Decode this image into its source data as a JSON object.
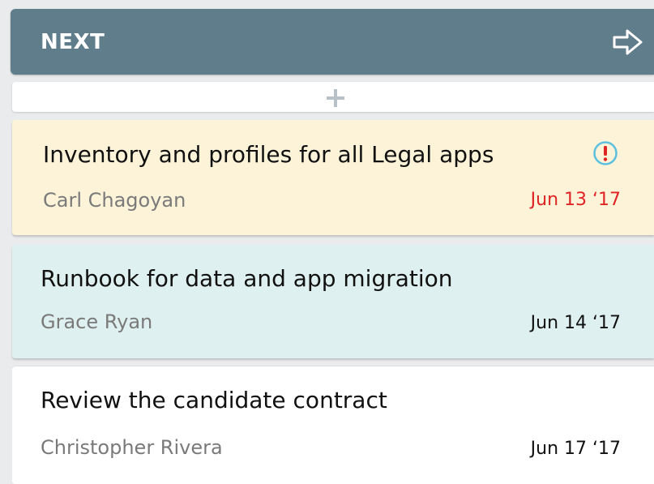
{
  "column": {
    "title": "NEXT",
    "move_icon": "arrow-right-icon",
    "add_icon": "plus-icon"
  },
  "cards": [
    {
      "title": "Inventory and profiles for all Legal apps",
      "assignee": "Carl Chagoyan",
      "due_date": "Jun 13 ‘17",
      "background": "#fdf3d9",
      "date_color": "#e02424",
      "status_icon": "alert-icon"
    },
    {
      "title": "Runbook for data and app migration",
      "assignee": "Grace Ryan",
      "due_date": "Jun 14 ‘17",
      "background": "#def0ef",
      "date_color": "#111111"
    },
    {
      "title": "Review the candidate contract",
      "assignee": "Christopher Rivera",
      "due_date": "Jun 17 ‘17",
      "background": "#ffffff",
      "date_color": "#111111"
    }
  ],
  "colors": {
    "header": "#607d8b",
    "alert_ring": "#5bc0de",
    "alert_mark": "#e02424"
  }
}
